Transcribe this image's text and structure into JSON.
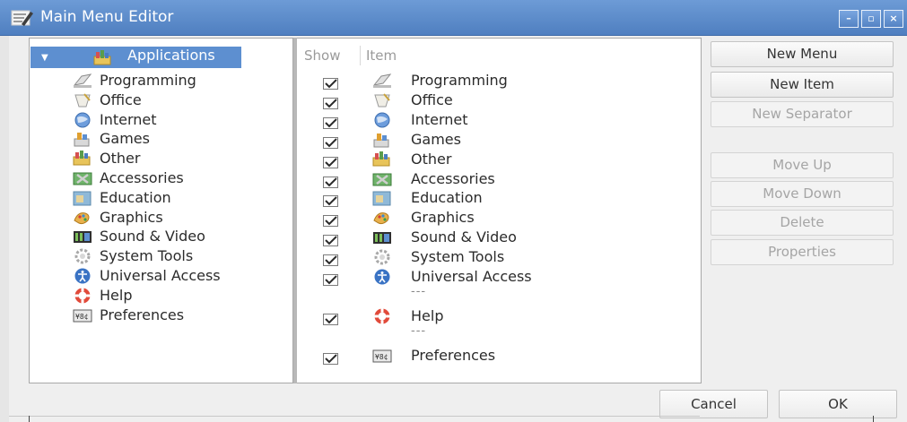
{
  "window": {
    "title": "Main Menu Editor",
    "accent_color": "#5d8fd0",
    "controls": [
      "minimize-icon",
      "maximize-icon",
      "close-icon"
    ]
  },
  "tree": {
    "root": {
      "label": "Applications",
      "icon": "applications-icon",
      "expanded": true,
      "selected": true
    },
    "items": [
      {
        "label": "Programming",
        "icon": "programming-icon"
      },
      {
        "label": "Office",
        "icon": "office-icon"
      },
      {
        "label": "Internet",
        "icon": "internet-icon"
      },
      {
        "label": "Games",
        "icon": "games-icon"
      },
      {
        "label": "Other",
        "icon": "other-icon"
      },
      {
        "label": "Accessories",
        "icon": "accessories-icon"
      },
      {
        "label": "Education",
        "icon": "education-icon"
      },
      {
        "label": "Graphics",
        "icon": "graphics-icon"
      },
      {
        "label": "Sound & Video",
        "icon": "sound-video-icon"
      },
      {
        "label": "System Tools",
        "icon": "system-tools-icon"
      },
      {
        "label": "Universal Access",
        "icon": "universal-access-icon"
      },
      {
        "label": "Help",
        "icon": "help-icon"
      },
      {
        "label": "Preferences",
        "icon": "preferences-icon"
      }
    ]
  },
  "list": {
    "columns": {
      "show": "Show",
      "item": "Item"
    },
    "rows": [
      {
        "type": "item",
        "show": true,
        "label": "Programming",
        "icon": "programming-icon"
      },
      {
        "type": "item",
        "show": true,
        "label": "Office",
        "icon": "office-icon"
      },
      {
        "type": "item",
        "show": true,
        "label": "Internet",
        "icon": "internet-icon"
      },
      {
        "type": "item",
        "show": true,
        "label": "Games",
        "icon": "games-icon"
      },
      {
        "type": "item",
        "show": true,
        "label": "Other",
        "icon": "other-icon"
      },
      {
        "type": "item",
        "show": true,
        "label": "Accessories",
        "icon": "accessories-icon"
      },
      {
        "type": "item",
        "show": true,
        "label": "Education",
        "icon": "education-icon"
      },
      {
        "type": "item",
        "show": true,
        "label": "Graphics",
        "icon": "graphics-icon"
      },
      {
        "type": "item",
        "show": true,
        "label": "Sound & Video",
        "icon": "sound-video-icon"
      },
      {
        "type": "item",
        "show": true,
        "label": "System Tools",
        "icon": "system-tools-icon"
      },
      {
        "type": "item",
        "show": true,
        "label": "Universal Access",
        "icon": "universal-access-icon"
      },
      {
        "type": "separator",
        "label": "---"
      },
      {
        "type": "item",
        "show": true,
        "label": "Help",
        "icon": "help-icon"
      },
      {
        "type": "separator",
        "label": "---"
      },
      {
        "type": "item",
        "show": true,
        "label": "Preferences",
        "icon": "preferences-icon"
      }
    ]
  },
  "buttons": {
    "new_menu": {
      "label": "New Menu",
      "enabled": true
    },
    "new_item": {
      "label": "New Item",
      "enabled": true
    },
    "new_separator": {
      "label": "New Separator",
      "enabled": false
    },
    "move_up": {
      "label": "Move Up",
      "enabled": false
    },
    "move_down": {
      "label": "Move Down",
      "enabled": false
    },
    "delete": {
      "label": "Delete",
      "enabled": false
    },
    "properties": {
      "label": "Properties",
      "enabled": false
    }
  },
  "footer": {
    "cancel": "Cancel",
    "ok": "OK"
  }
}
